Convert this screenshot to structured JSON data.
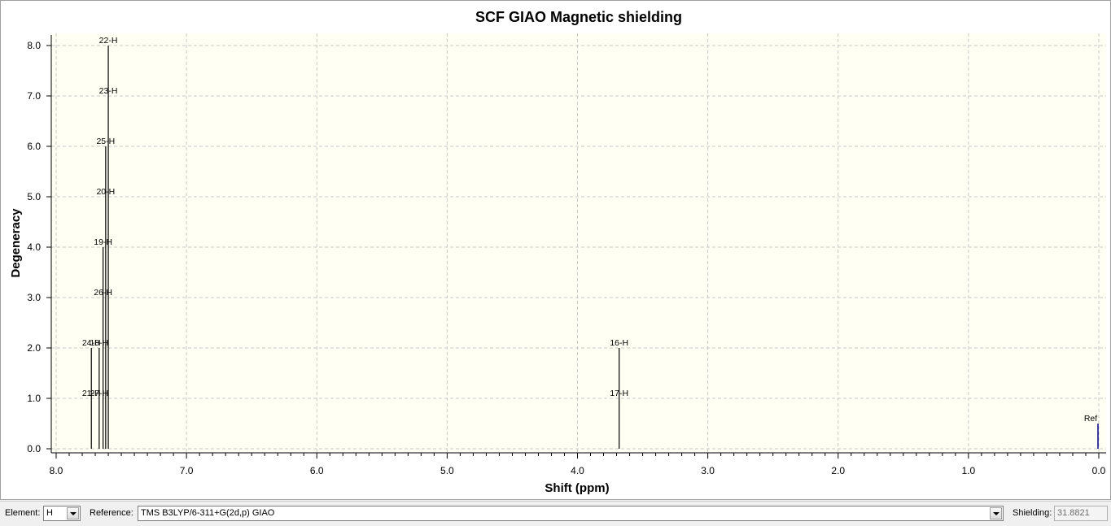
{
  "chart_data": {
    "type": "bar",
    "title": "SCF GIAO Magnetic shielding",
    "xlabel": "Shift (ppm)",
    "ylabel": "Degeneracy",
    "xlim": [
      8.0,
      0.0
    ],
    "ylim": [
      0.0,
      8.2
    ],
    "x_reversed": true,
    "xticks": [
      "8.0",
      "7.0",
      "6.0",
      "5.0",
      "4.0",
      "3.0",
      "2.0",
      "1.0",
      "0.0"
    ],
    "yticks": [
      "0.0",
      "1.0",
      "2.0",
      "3.0",
      "4.0",
      "5.0",
      "6.0",
      "7.0",
      "8.0"
    ],
    "grid": true,
    "background_color": "#fffff3",
    "peaks": [
      {
        "shift": 7.73,
        "degeneracy": 2,
        "labels": [
          "21-H",
          "24-H"
        ]
      },
      {
        "shift": 7.67,
        "degeneracy": 2,
        "labels": [
          "27-H",
          "18-H"
        ]
      },
      {
        "shift": 7.64,
        "degeneracy": 4,
        "labels": [
          "26-H",
          "19-H"
        ]
      },
      {
        "shift": 7.62,
        "degeneracy": 6,
        "labels": [
          "20-H",
          "25-H"
        ]
      },
      {
        "shift": 7.6,
        "degeneracy": 8,
        "labels": [
          "23-H",
          "22-H"
        ]
      },
      {
        "shift": 3.68,
        "degeneracy": 2,
        "labels": [
          "17-H",
          "16-H"
        ]
      }
    ],
    "reference": {
      "shift": 0.0,
      "degeneracy": 0.5,
      "label": "Ref",
      "color": "#00008b"
    }
  },
  "toolbar": {
    "element_label": "Element:",
    "element_value": "H",
    "reference_label": "Reference:",
    "reference_value": "TMS B3LYP/6-311+G(2d,p) GIAO",
    "shielding_label": "Shielding:",
    "shielding_value": "31.8821"
  }
}
